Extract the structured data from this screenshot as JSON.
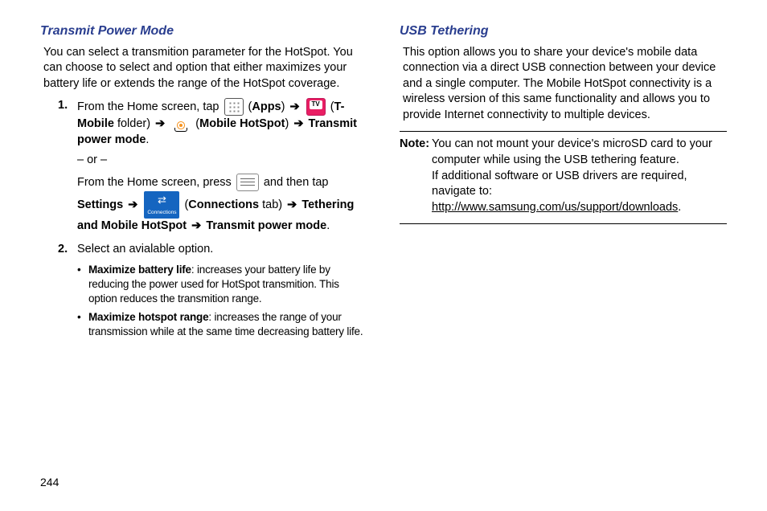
{
  "pageNumber": "244",
  "left": {
    "heading": "Transmit Power Mode",
    "intro": "You can select a transmition parameter for the HotSpot. You can choose to select and option that either maximizes your battery life or extends the range of the HotSpot coverage.",
    "step1_pre": "From the Home screen, tap ",
    "apps": "Apps",
    "tmobile": "T-Mobile",
    "folder": " folder) ",
    "mobilehotspot": "Mobile HotSpot",
    "transmit": "Transmit power mode",
    "or": "– or –",
    "step1b_pre": "From the Home screen, press ",
    "step1b_mid": " and then tap ",
    "settings": "Settings",
    "connections": "Connections",
    "tab": " tab) ",
    "tethering": "Tethering and Mobile HotSpot",
    "step2": "Select an avialable option.",
    "bullet1_head": "Maximize battery life",
    "bullet1_body": ": increases your battery life by reducing the power used for HotSpot transmition. This option reduces the transmition range.",
    "bullet2_head": "Maximize hotspot range",
    "bullet2_body": ": increases the range of your transmission while at the same time decreasing battery life."
  },
  "right": {
    "heading": "USB Tethering",
    "intro": "This option allows you to share your device's mobile data connection via a direct USB connection between your device and a single computer. The Mobile HotSpot connectivity is a wireless version of this same functionality and allows you to provide Internet connectivity to multiple devices.",
    "note_label": "Note:",
    "note_line1": "You can not mount your device's microSD card to your computer while using the USB tethering feature.",
    "note_line2a": "If additional software or USB drivers are required, navigate to: ",
    "note_link": "http://www.samsung.com/us/support/downloads",
    "note_line2b": "."
  }
}
